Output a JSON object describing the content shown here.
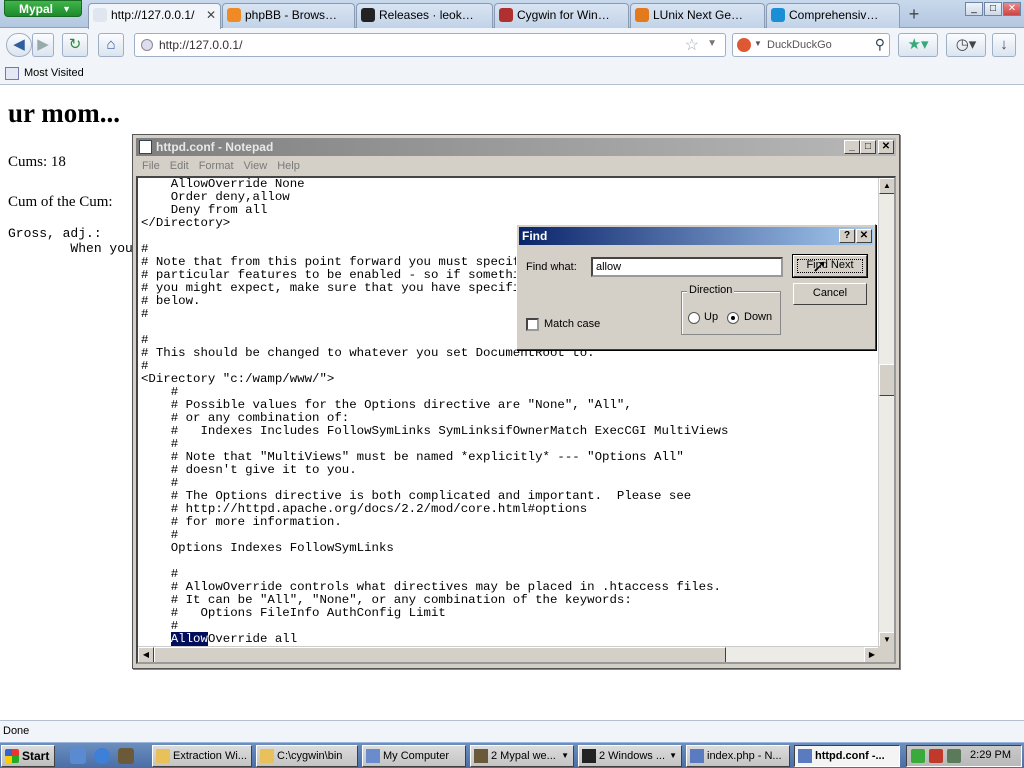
{
  "browser": {
    "app_button": "Mypal",
    "tabs": [
      {
        "label": "http://127.0.0.1/",
        "active": true,
        "icon_color": "#dfe6f0"
      },
      {
        "label": "phpBB - Browse /ph...",
        "active": false,
        "icon_color": "#f08a24"
      },
      {
        "label": "Releases · leokhoa/l...",
        "active": false,
        "icon_color": "#222222"
      },
      {
        "label": "Cygwin for Windows...",
        "active": false,
        "icon_color": "#b03030"
      },
      {
        "label": "LUnix Next Generati...",
        "active": false,
        "icon_color": "#e37b1d"
      },
      {
        "label": "Comprehensive IP a...",
        "active": false,
        "icon_color": "#1a8fd6"
      }
    ],
    "new_tab": "+",
    "window_buttons": [
      "_",
      "□",
      "✕"
    ],
    "url": "http://127.0.0.1/",
    "search_placeholder": "DuckDuckGo",
    "bookmark": "Most Visited",
    "status": "Done"
  },
  "page": {
    "heading": "ur mom...",
    "cums": "Cums: 18",
    "cum_of_cum": "Cum of the Cum:",
    "pre_text": "Gross, adj.:\n        When you"
  },
  "notepad": {
    "title": "httpd.conf - Notepad",
    "menu": [
      "File",
      "Edit",
      "Format",
      "View",
      "Help"
    ],
    "lines": [
      "    AllowOverride None",
      "    Order deny,allow",
      "    Deny from all",
      "</Directory>",
      "",
      "#",
      "# Note that from this point forward you must specifically allow",
      "# particular features to be enabled - so if something's not working as",
      "# you might expect, make sure that you have specifically enabled it",
      "# below.",
      "#",
      "",
      "#",
      "# This should be changed to whatever you set DocumentRoot to.",
      "#",
      "<Directory \"c:/wamp/www/\">",
      "    #",
      "    # Possible values for the Options directive are \"None\", \"All\",",
      "    # or any combination of:",
      "    #   Indexes Includes FollowSymLinks SymLinksifOwnerMatch ExecCGI MultiViews",
      "    #",
      "    # Note that \"MultiViews\" must be named *explicitly* --- \"Options All\"",
      "    # doesn't give it to you.",
      "    #",
      "    # The Options directive is both complicated and important.  Please see",
      "    # http://httpd.apache.org/docs/2.2/mod/core.html#options",
      "    # for more information.",
      "    #",
      "    Options Indexes FollowSymLinks",
      "",
      "    #",
      "    # AllowOverride controls what directives may be placed in .htaccess files.",
      "    # It can be \"All\", \"None\", or any combination of the keywords:",
      "    #   Options FileInfo AuthConfig Limit",
      "    #"
    ],
    "last_line_indent": "    ",
    "last_line_highlight": "Allow",
    "last_line_rest": "Override all"
  },
  "find_dialog": {
    "title": "Find",
    "help": "?",
    "close": "✕",
    "find_what_label": "Find what:",
    "find_what_value": "allow",
    "find_next": "Find Next",
    "cancel": "Cancel",
    "direction_label": "Direction",
    "up": "Up",
    "down": "Down",
    "selected_direction": "down",
    "match_case": "Match case",
    "match_case_checked": false
  },
  "taskbar": {
    "start": "Start",
    "tasks": [
      {
        "label": "Extraction Wi...",
        "icon_color": "#e8c15a",
        "active": false,
        "dropdown": false
      },
      {
        "label": "C:\\cygwin\\bin",
        "icon_color": "#e8c15a",
        "active": false,
        "dropdown": false
      },
      {
        "label": "My Computer",
        "icon_color": "#6a8ccc",
        "active": false,
        "dropdown": false
      },
      {
        "label": "2 Mypal we...",
        "icon_color": "#6b5a3a",
        "active": false,
        "dropdown": true
      },
      {
        "label": "2 Windows ...",
        "icon_color": "#222222",
        "active": false,
        "dropdown": true
      },
      {
        "label": "index.php - N...",
        "icon_color": "#5a7bbf",
        "active": false,
        "dropdown": false
      },
      {
        "label": "httpd.conf -...",
        "icon_color": "#5a7bbf",
        "active": true,
        "dropdown": false
      }
    ],
    "clock": "2:29 PM"
  }
}
